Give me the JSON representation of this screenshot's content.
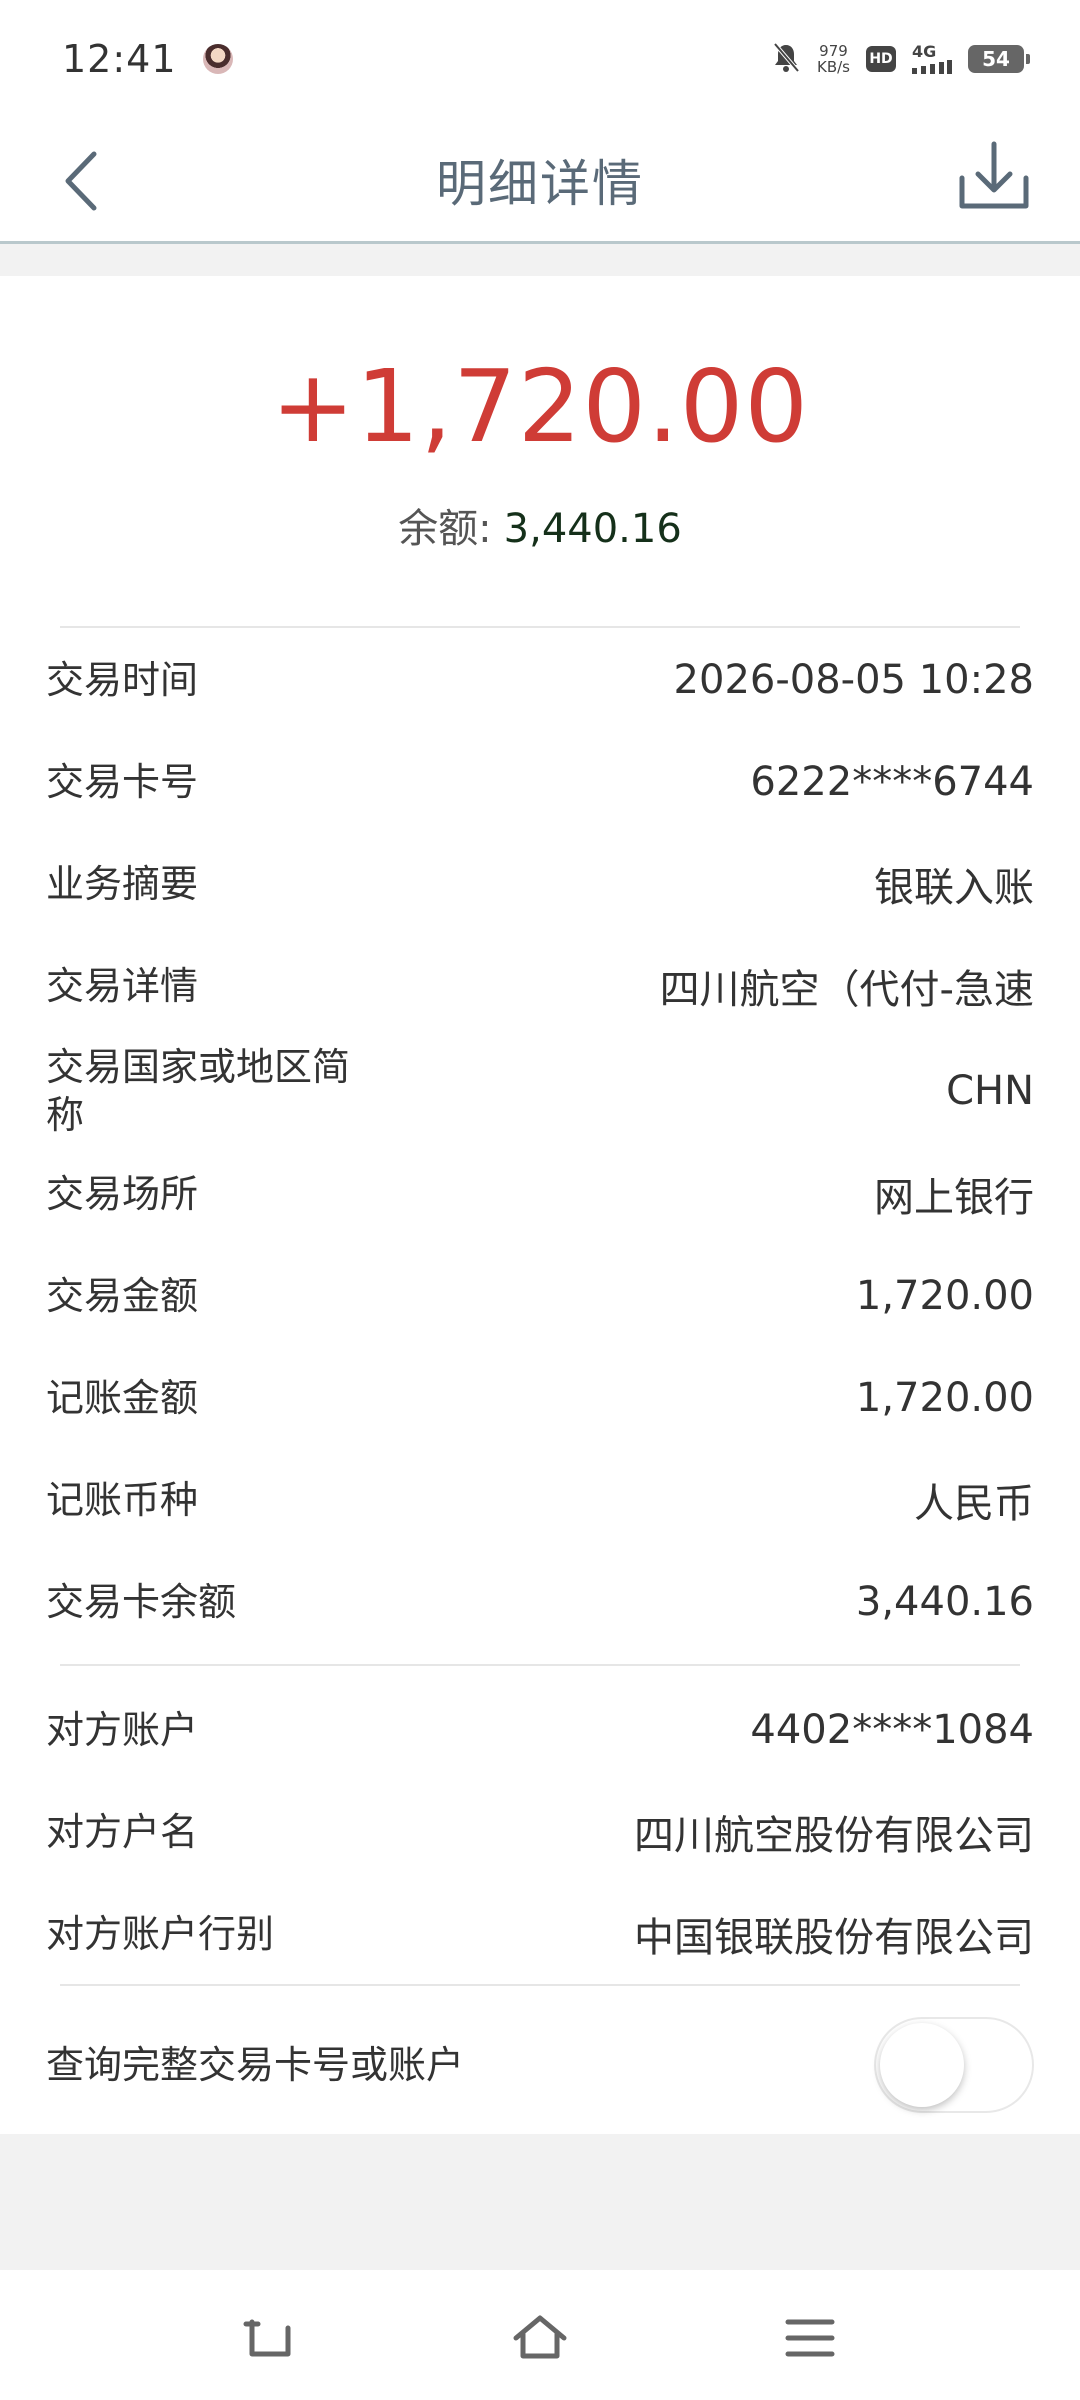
{
  "status_bar": {
    "time": "12:41",
    "speed_value": "979",
    "speed_unit": "KB/s",
    "hd_label": "HD",
    "network_label": "4G",
    "battery": "54",
    "icons": [
      "avatar",
      "mute-bell-icon",
      "hd-icon",
      "signal-4g-icon",
      "battery-icon"
    ]
  },
  "header": {
    "title": "明细详情",
    "back_icon": "chevron-left-icon",
    "download_icon": "download-icon"
  },
  "summary": {
    "amount": "+1,720.00",
    "amount_color": "#cf3c36",
    "balance_label": "余额:",
    "balance_value": "3,440.16"
  },
  "details": [
    {
      "label": "交易时间",
      "value": "2026-08-05  10:28"
    },
    {
      "label": "交易卡号",
      "value": "6222****6744"
    },
    {
      "label": "业务摘要",
      "value": "银联入账"
    },
    {
      "label": "交易详情",
      "value": "四川航空（代付-急速"
    },
    {
      "label": "交易国家或地区简称",
      "value": "CHN"
    },
    {
      "label": "交易场所",
      "value": "网上银行"
    },
    {
      "label": "交易金额",
      "value": "1,720.00"
    },
    {
      "label": "记账金额",
      "value": "1,720.00"
    },
    {
      "label": "记账币种",
      "value": "人民币"
    },
    {
      "label": "交易卡余额",
      "value": "3,440.16"
    }
  ],
  "counterparty": [
    {
      "label": "对方账户",
      "value": "4402****1084"
    },
    {
      "label": "对方户名",
      "value": "四川航空股份有限公司"
    },
    {
      "label": "对方账户行别",
      "value": "中国银联股份有限公司"
    }
  ],
  "toggle": {
    "label": "查询完整交易卡号或账户",
    "state": "off"
  },
  "bottom_nav": {
    "icons": [
      "back-gesture-icon",
      "home-icon",
      "menu-icon"
    ]
  }
}
